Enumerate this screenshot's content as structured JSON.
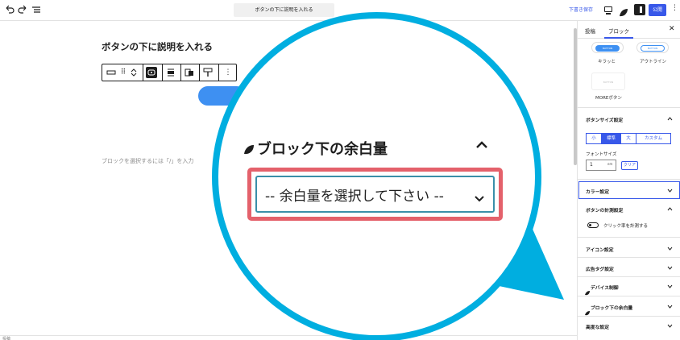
{
  "topbar": {
    "undo_icon": "undo-icon",
    "redo_icon": "redo-icon",
    "list_view_icon": "list-view-icon",
    "document_title": "ボタンの下に説明を入れる",
    "save_draft": "下書き保存",
    "publish": "公開",
    "colors": {
      "accent": "#3858e9"
    }
  },
  "canvas": {
    "heading": "ボタンの下に説明を入れる",
    "block_hint": "ブロックを選択するには「/」を入力",
    "footer_text": "投稿",
    "button_color": "#3e90f2"
  },
  "sidebar": {
    "tabs": [
      "投稿",
      "ブロック"
    ],
    "styles": [
      {
        "label": "キラッと",
        "mini": "BUTTON"
      },
      {
        "label": "アウトライン",
        "mini": "BUTTON"
      },
      {
        "label": "MOREボタン",
        "mini": "BUTTON"
      }
    ],
    "size_section": {
      "title": "ボタンサイズ設定",
      "options": [
        "小",
        "標準",
        "大",
        "カスタム"
      ],
      "selected": "標準"
    },
    "font_size": {
      "label": "フォントサイズ",
      "value": "1",
      "unit": "em",
      "clear": "クリア"
    },
    "sections": [
      "カラー設定",
      "ボタンの計測設定",
      "アイコン設定",
      "広告タグ設定",
      "デバイス制御",
      "ブロック下の余白量",
      "高度な設定"
    ],
    "measure_toggle_label": "クリック率を計測する"
  },
  "magnifier": {
    "panel_title": "ブロック下の余白量",
    "select_placeholder": "-- 余白量を選択して下さい --",
    "ring_color": "#00aee0",
    "highlight_color": "#e4616b"
  }
}
